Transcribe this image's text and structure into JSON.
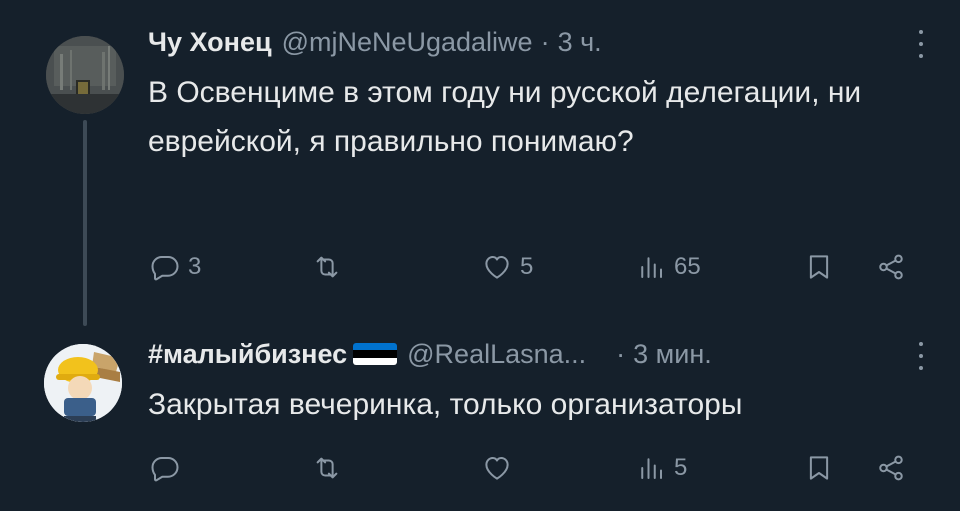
{
  "tweets": [
    {
      "author_name": "Чу Хонец",
      "handle": "@mjNeNeUgadaliwe",
      "separator": "·",
      "time": "3 ч.",
      "text": "В Освенциме в этом году ни русской делегации, ни еврейской, я правильно понимаю?",
      "avatar": "dark-photo-avatar",
      "stats": {
        "replies": "3",
        "retweets": "",
        "likes": "5",
        "views": "65"
      }
    },
    {
      "author_name": "#малыйбизнес",
      "author_flag": "estonia-flag-icon",
      "handle": "@RealLasna...",
      "separator": "·",
      "time": "3 мин.",
      "text": "Закрытая вечеринка, только организаторы",
      "avatar": "cartoon-character-avatar",
      "stats": {
        "replies": "",
        "retweets": "",
        "likes": "",
        "views": "5"
      }
    }
  ],
  "icons": {
    "reply": "reply-icon",
    "retweet": "retweet-icon",
    "like": "heart-icon",
    "views": "views-icon",
    "bookmark": "bookmark-icon",
    "share": "share-icon",
    "more": "more-icon"
  },
  "colors": {
    "background": "#15202b",
    "primary_text": "#e7e9ea",
    "secondary_text": "#8b98a5",
    "thread_line": "#3d4a56",
    "flag": [
      "#0072ce",
      "#000000",
      "#ffffff"
    ]
  }
}
